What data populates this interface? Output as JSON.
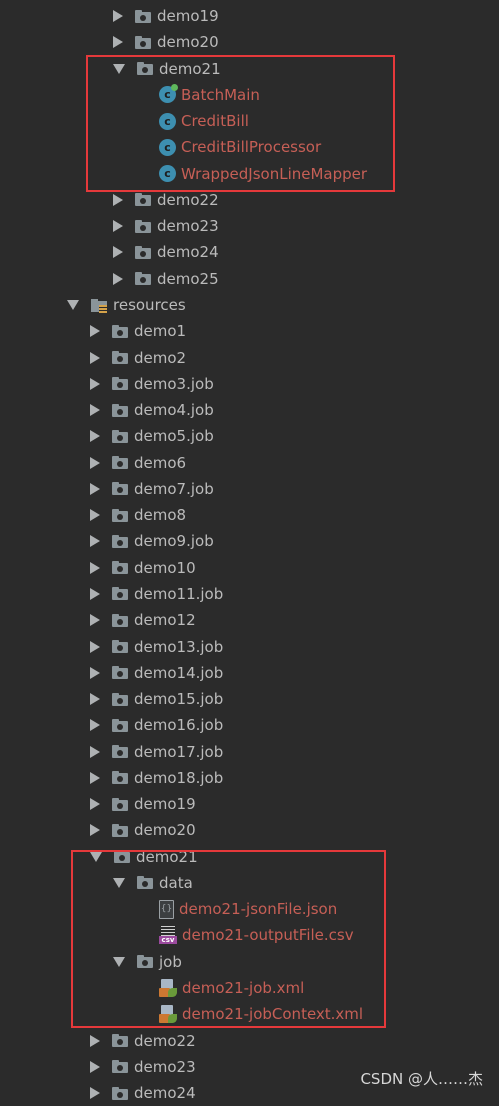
{
  "tree": [
    {
      "label": "demo19",
      "type": "folder",
      "state": "collapsed",
      "depth": 3
    },
    {
      "label": "demo20",
      "type": "folder",
      "state": "collapsed",
      "depth": 3
    },
    {
      "label": "demo21",
      "type": "folder",
      "state": "expanded",
      "depth": 3
    },
    {
      "label": "BatchMain",
      "type": "class-run",
      "state": "none",
      "depth": 4,
      "color": "red"
    },
    {
      "label": "CreditBill",
      "type": "class",
      "state": "none",
      "depth": 4,
      "color": "red"
    },
    {
      "label": "CreditBillProcessor",
      "type": "class",
      "state": "none",
      "depth": 4,
      "color": "red"
    },
    {
      "label": "WrappedJsonLineMapper",
      "type": "class",
      "state": "none",
      "depth": 4,
      "color": "red"
    },
    {
      "label": "demo22",
      "type": "folder",
      "state": "collapsed",
      "depth": 3
    },
    {
      "label": "demo23",
      "type": "folder",
      "state": "collapsed",
      "depth": 3
    },
    {
      "label": "demo24",
      "type": "folder",
      "state": "collapsed",
      "depth": 3
    },
    {
      "label": "demo25",
      "type": "folder",
      "state": "collapsed",
      "depth": 3
    },
    {
      "label": "resources",
      "type": "resources",
      "state": "expanded",
      "depth": 1
    },
    {
      "label": "demo1",
      "type": "folder",
      "state": "collapsed",
      "depth": 2
    },
    {
      "label": "demo2",
      "type": "folder",
      "state": "collapsed",
      "depth": 2
    },
    {
      "label": "demo3.job",
      "type": "folder",
      "state": "collapsed",
      "depth": 2
    },
    {
      "label": "demo4.job",
      "type": "folder",
      "state": "collapsed",
      "depth": 2
    },
    {
      "label": "demo5.job",
      "type": "folder",
      "state": "collapsed",
      "depth": 2
    },
    {
      "label": "demo6",
      "type": "folder",
      "state": "collapsed",
      "depth": 2
    },
    {
      "label": "demo7.job",
      "type": "folder",
      "state": "collapsed",
      "depth": 2
    },
    {
      "label": "demo8",
      "type": "folder",
      "state": "collapsed",
      "depth": 2
    },
    {
      "label": "demo9.job",
      "type": "folder",
      "state": "collapsed",
      "depth": 2
    },
    {
      "label": "demo10",
      "type": "folder",
      "state": "collapsed",
      "depth": 2
    },
    {
      "label": "demo11.job",
      "type": "folder",
      "state": "collapsed",
      "depth": 2
    },
    {
      "label": "demo12",
      "type": "folder",
      "state": "collapsed",
      "depth": 2
    },
    {
      "label": "demo13.job",
      "type": "folder",
      "state": "collapsed",
      "depth": 2
    },
    {
      "label": "demo14.job",
      "type": "folder",
      "state": "collapsed",
      "depth": 2
    },
    {
      "label": "demo15.job",
      "type": "folder",
      "state": "collapsed",
      "depth": 2
    },
    {
      "label": "demo16.job",
      "type": "folder",
      "state": "collapsed",
      "depth": 2
    },
    {
      "label": "demo17.job",
      "type": "folder",
      "state": "collapsed",
      "depth": 2
    },
    {
      "label": "demo18.job",
      "type": "folder",
      "state": "collapsed",
      "depth": 2
    },
    {
      "label": "demo19",
      "type": "folder",
      "state": "collapsed",
      "depth": 2
    },
    {
      "label": "demo20",
      "type": "folder",
      "state": "collapsed",
      "depth": 2
    },
    {
      "label": "demo21",
      "type": "folder",
      "state": "expanded",
      "depth": 2
    },
    {
      "label": "data",
      "type": "folder",
      "state": "expanded",
      "depth": 3
    },
    {
      "label": "demo21-jsonFile.json",
      "type": "json",
      "state": "none",
      "depth": 4,
      "color": "red"
    },
    {
      "label": "demo21-outputFile.csv",
      "type": "csv",
      "state": "none",
      "depth": 4,
      "color": "red"
    },
    {
      "label": "job",
      "type": "folder",
      "state": "expanded",
      "depth": 3
    },
    {
      "label": "demo21-job.xml",
      "type": "xml",
      "state": "none",
      "depth": 4,
      "color": "red"
    },
    {
      "label": "demo21-jobContext.xml",
      "type": "xml",
      "state": "none",
      "depth": 4,
      "color": "red"
    },
    {
      "label": "demo22",
      "type": "folder",
      "state": "collapsed",
      "depth": 2
    },
    {
      "label": "demo23",
      "type": "folder",
      "state": "collapsed",
      "depth": 2
    },
    {
      "label": "demo24",
      "type": "folder",
      "state": "collapsed",
      "depth": 2
    }
  ],
  "watermark": "CSDN @人……杰",
  "colors": {
    "background": "#2b2b2b",
    "text": "#bbbbbb",
    "changed": "#c65f56",
    "highlight": "#e5393b"
  }
}
